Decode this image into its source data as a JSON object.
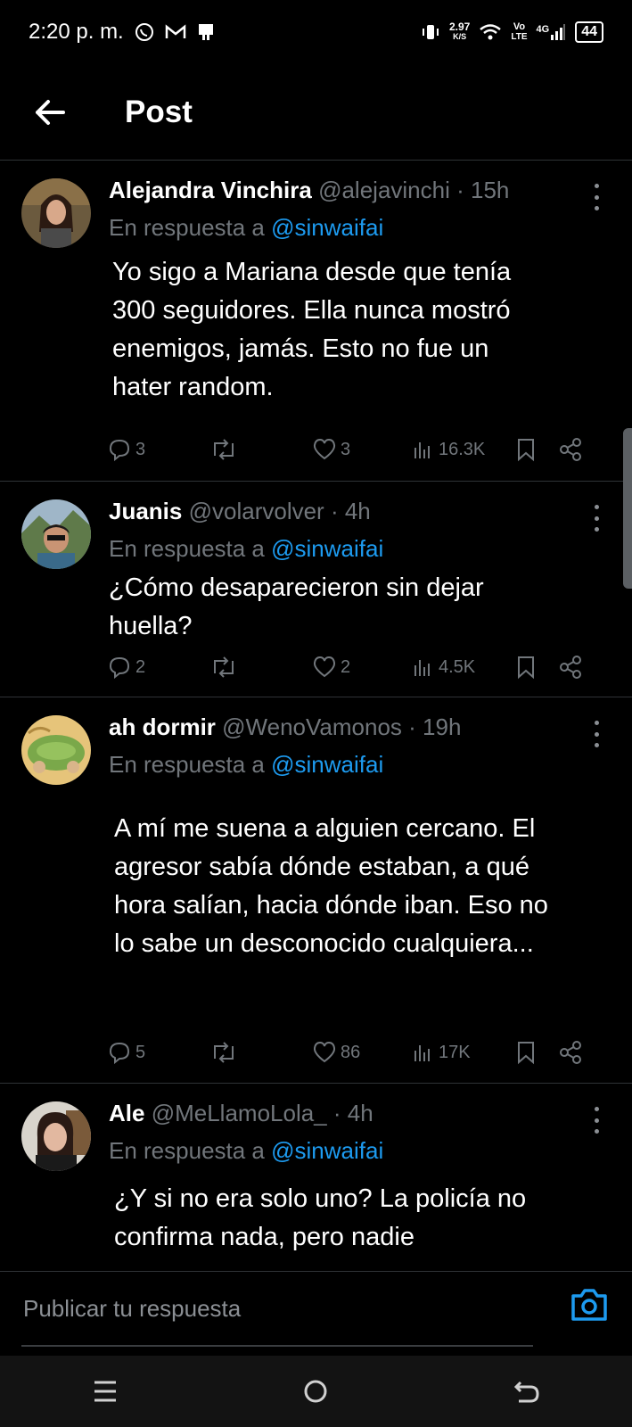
{
  "status_bar": {
    "time": "2:20 p. m.",
    "speed_value": "2.97",
    "speed_unit": "K/S",
    "vo_label": "Vo",
    "lte_label": "LTE",
    "network": "4G",
    "battery": "44"
  },
  "header": {
    "title": "Post"
  },
  "tweets": [
    {
      "name": "Alejandra Vinchira",
      "handle": "@alejavinchi",
      "time": "· 15h",
      "reply_prefix": "En respuesta a",
      "reply_to": "@sinwaifai",
      "text": "Yo sigo a Mariana desde que tenía\n300 seguidores. Ella nunca mostró\nenemigos, jamás. Esto no fue un\nhater random.",
      "replies": "3",
      "retweets": "",
      "likes": "3",
      "views": "16.3K"
    },
    {
      "name": "Juanis",
      "handle": "@volarvolver",
      "time": "· 4h",
      "reply_prefix": "En respuesta a",
      "reply_to": "@sinwaifai",
      "text": "¿Cómo desaparecieron sin dejar\nhuella?",
      "replies": "2",
      "retweets": "",
      "likes": "2",
      "views": "4.5K"
    },
    {
      "name": "ah dormir",
      "handle": "@WenoVamonos",
      "time": "· 19h",
      "reply_prefix": "En respuesta a",
      "reply_to": "@sinwaifai",
      "text": "A mí me suena a alguien cercano. El\nagresor sabía dónde estaban, a qué\nhora salían, hacia dónde iban. Eso no\nlo sabe un desconocido cualquiera...",
      "replies": "5",
      "retweets": "",
      "likes": "86",
      "views": "17K"
    },
    {
      "name": "Ale",
      "handle": "@MeLlamoLola_",
      "time": "· 4h",
      "reply_prefix": "En respuesta a",
      "reply_to": "@sinwaifai",
      "text": "¿Y si no era solo uno? La policía no\nconfirma nada, pero nadie"
    }
  ],
  "composer": {
    "placeholder": "Publicar tu respuesta"
  },
  "colors": {
    "background": "#000000",
    "accent": "#1d9bf0",
    "muted": "#71767b",
    "divider": "#2f3336"
  }
}
